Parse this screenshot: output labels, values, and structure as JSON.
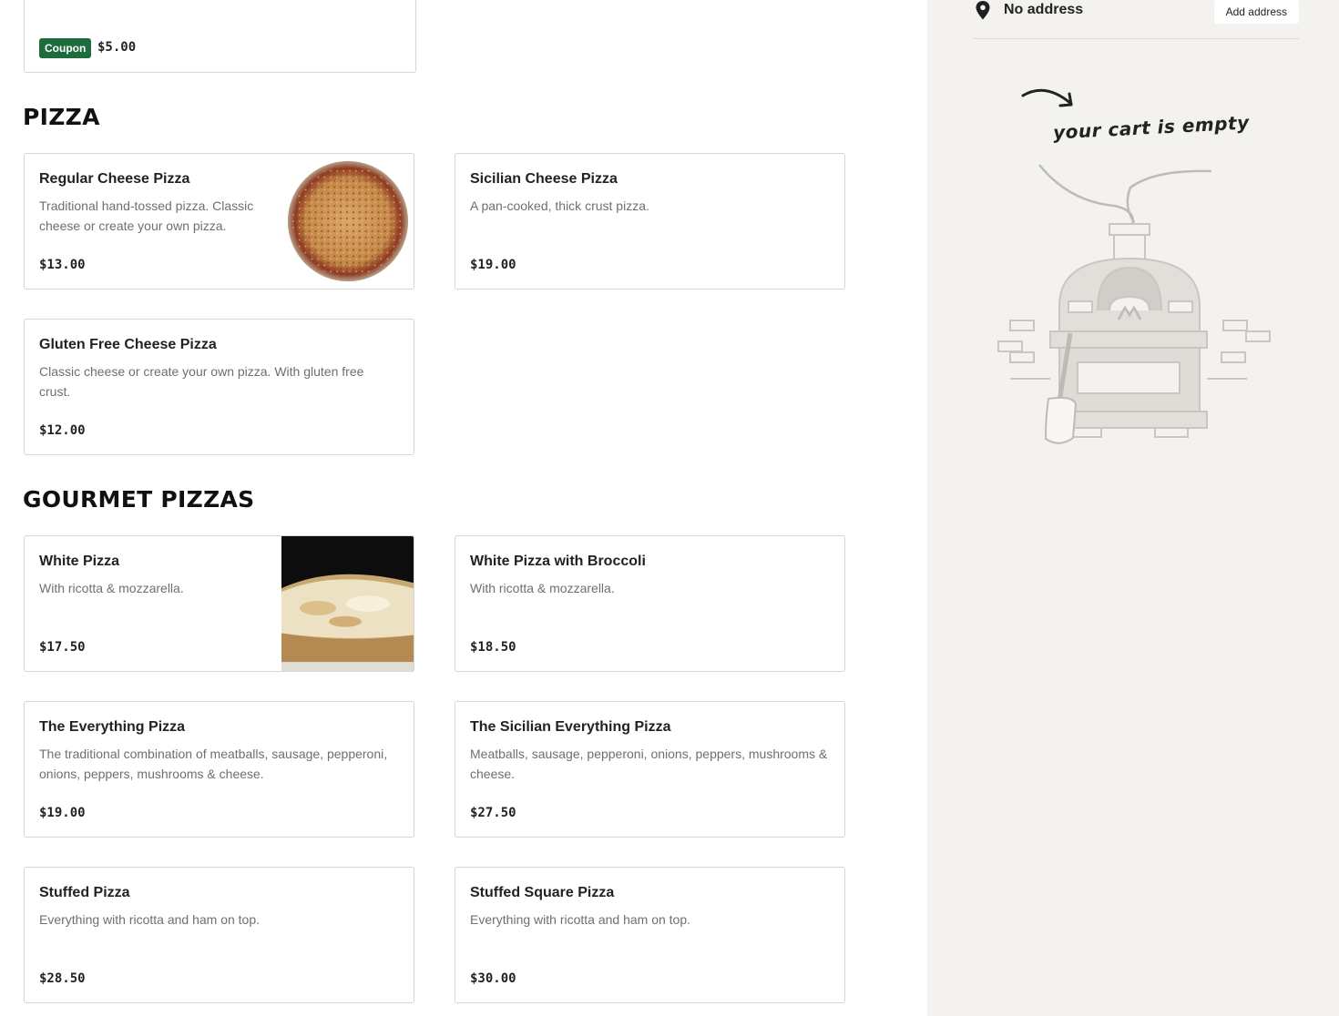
{
  "coupon": {
    "badge": "Coupon",
    "price": "$5.00"
  },
  "sections": [
    {
      "title": "PIZZA",
      "items": [
        {
          "name": "Regular Cheese Pizza",
          "description": "Traditional hand-tossed pizza. Classic cheese or create your own pizza.",
          "price": "$13.00",
          "image": "round-cheese-pizza"
        },
        {
          "name": "Sicilian Cheese Pizza",
          "description": "A pan-cooked, thick crust pizza.",
          "price": "$19.00"
        },
        {
          "name": "Gluten Free Cheese Pizza",
          "description": "Classic cheese or create your own pizza. With gluten free crust.",
          "price": "$12.00"
        }
      ]
    },
    {
      "title": "GOURMET PIZZAS",
      "items": [
        {
          "name": "White Pizza",
          "description": "With ricotta & mozzarella.",
          "price": "$17.50",
          "image": "white-pizza-slice"
        },
        {
          "name": "White Pizza with Broccoli",
          "description": "With ricotta & mozzarella.",
          "price": "$18.50"
        },
        {
          "name": "The Everything Pizza",
          "description": "The traditional combination of meatballs, sausage, pepperoni, onions, peppers, mushrooms & cheese.",
          "price": "$19.00"
        },
        {
          "name": "The Sicilian Everything Pizza",
          "description": "Meatballs, sausage, pepperoni, onions, peppers, mushrooms & cheese.",
          "price": "$27.50"
        },
        {
          "name": "Stuffed Pizza",
          "description": "Everything with ricotta and ham on top.",
          "price": "$28.50"
        },
        {
          "name": "Stuffed Square Pizza",
          "description": "Everything with ricotta and ham on top.",
          "price": "$30.00"
        }
      ]
    }
  ],
  "sidebar": {
    "address_icon": "location-pin-icon",
    "address_text": "No address",
    "add_address_label": "Add address",
    "cart_empty_text": "your cart is empty",
    "illustration": "pizza-oven-illustration"
  },
  "colors": {
    "coupon_green": "#1e6b3e",
    "sidebar_bg": "#f3f2ef",
    "border": "#d6d6d6"
  }
}
